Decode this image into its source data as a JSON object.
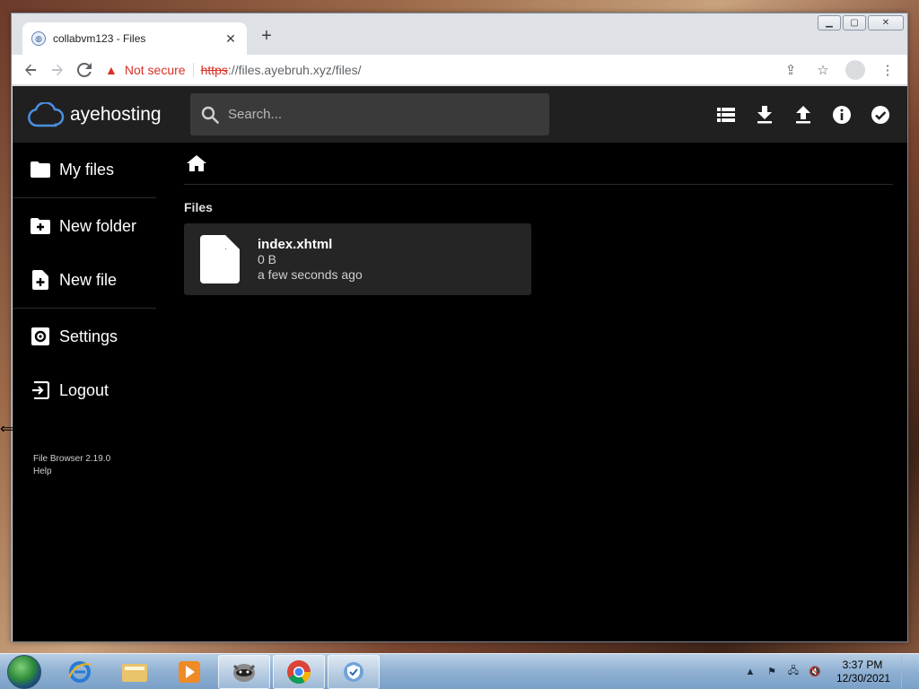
{
  "browser": {
    "tab_title": "collabvm123 - Files",
    "tab_close": "✕",
    "new_tab": "+",
    "not_secure": "Not secure",
    "url_scheme": "https",
    "url_rest": "://files.ayebruh.xyz/files/"
  },
  "app": {
    "brand": "ayehosting",
    "search_placeholder": "Search...",
    "sidebar": {
      "my_files": "My files",
      "new_folder": "New folder",
      "new_file": "New file",
      "settings": "Settings",
      "logout": "Logout",
      "version": "File Browser 2.19.0",
      "help": "Help"
    },
    "section_title": "Files",
    "files": [
      {
        "name": "index.xhtml",
        "size": "0 B",
        "modified": "a few seconds ago"
      }
    ]
  },
  "taskbar": {
    "time": "3:37 PM",
    "date": "12/30/2021"
  }
}
